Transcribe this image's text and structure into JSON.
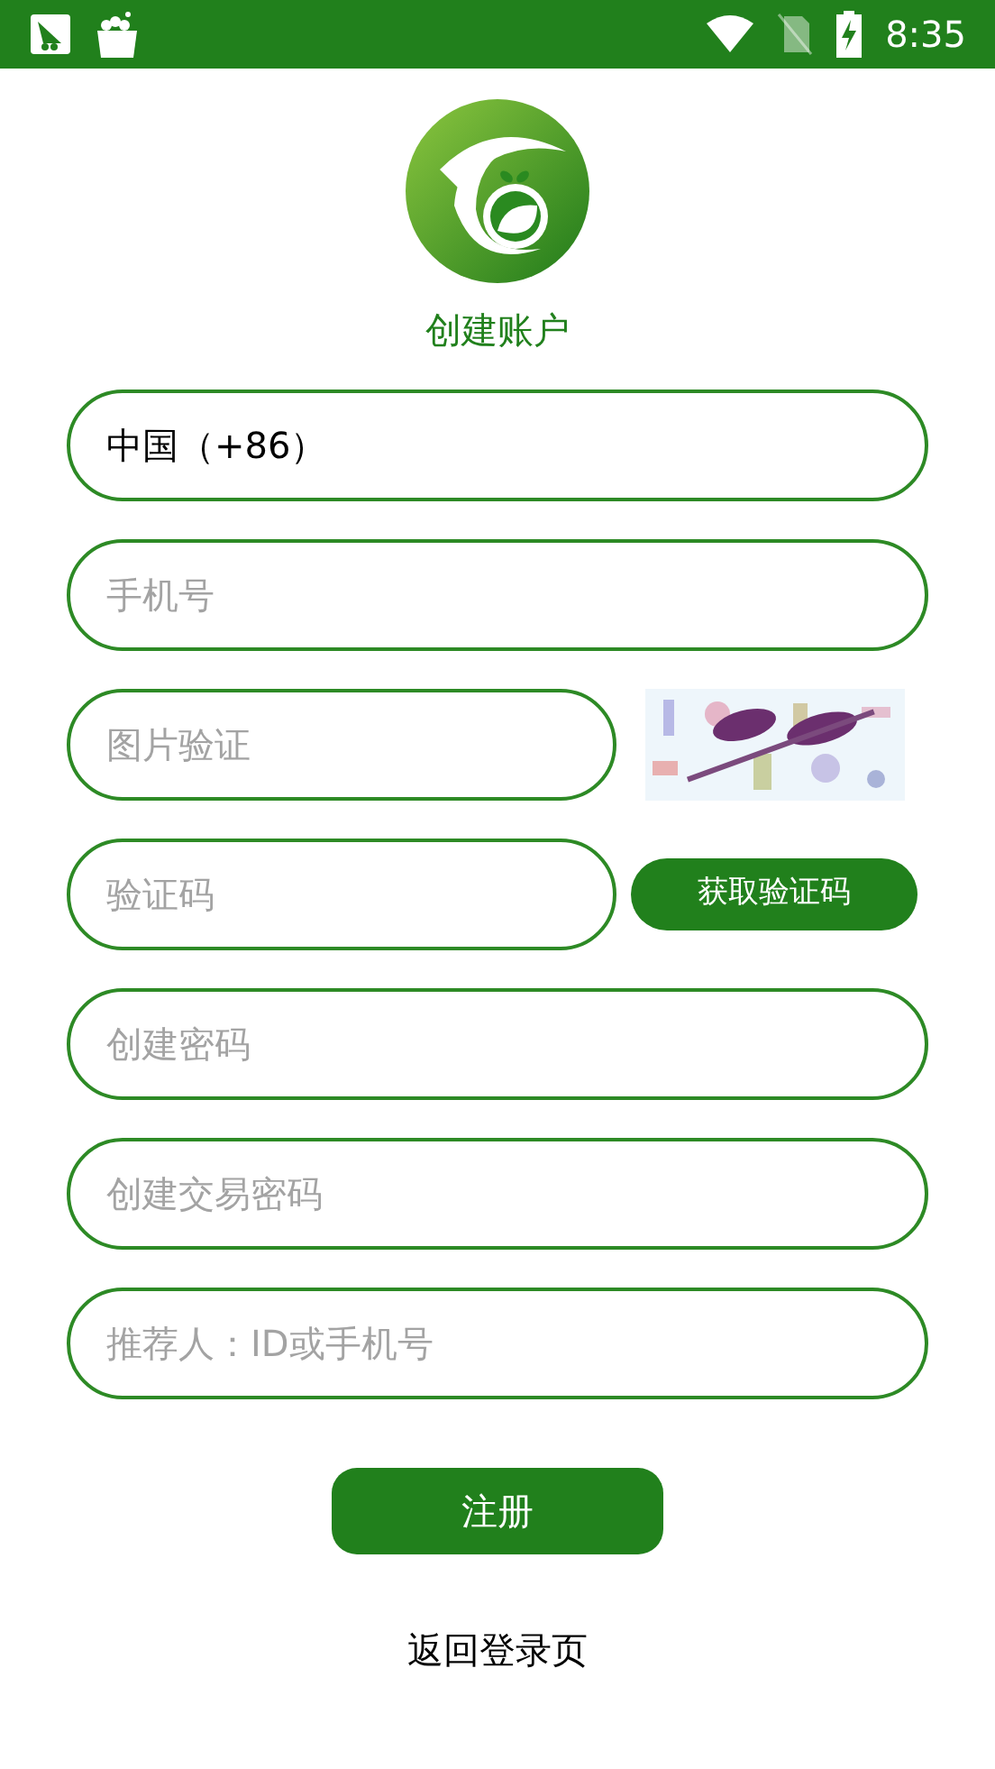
{
  "status_bar": {
    "time": "8:35"
  },
  "header": {
    "title": "创建账户"
  },
  "fields": [
    {
      "kind": "value",
      "value": "中国（+86）"
    },
    {
      "kind": "input",
      "placeholder": "手机号"
    },
    {
      "kind": "captcha",
      "placeholder": "图片验证"
    },
    {
      "kind": "code",
      "placeholder": "验证码",
      "button": "获取验证码"
    },
    {
      "kind": "input",
      "placeholder": "创建密码"
    },
    {
      "kind": "input",
      "placeholder": "创建交易密码"
    },
    {
      "kind": "input",
      "placeholder": "推荐人：ID或手机号"
    }
  ],
  "submit": "注册",
  "back_link": "返回登录页"
}
